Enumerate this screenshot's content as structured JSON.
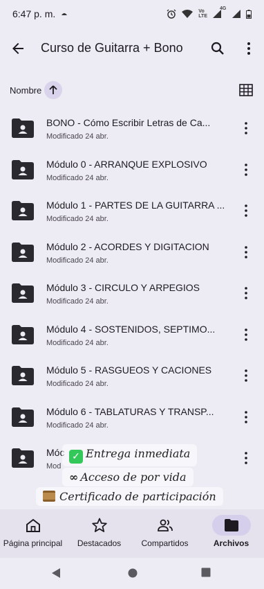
{
  "status_bar": {
    "time": "6:47 p. m.",
    "network_label_top": "Vo",
    "network_label_bottom": "LTE",
    "signal_label": "4G"
  },
  "app_bar": {
    "title": "Curso de Guitarra + Bono"
  },
  "sort": {
    "label": "Nombre"
  },
  "files": [
    {
      "name": "BONO - Cómo Escribir Letras de Ca...",
      "modified": "Modificado 24 abr."
    },
    {
      "name": "Módulo 0 - ARRANQUE EXPLOSIVO",
      "modified": "Modificado 24 abr."
    },
    {
      "name": "Módulo 1 - PARTES DE LA GUITARRA ...",
      "modified": "Modificado 24 abr."
    },
    {
      "name": "Módulo 2 - ACORDES Y DIGITACION",
      "modified": "Modificado 24 abr."
    },
    {
      "name": "Módulo 3 - CIRCULO Y ARPEGIOS",
      "modified": "Modificado 24 abr."
    },
    {
      "name": "Módulo 4 - SOSTENIDOS, SEPTIMO...",
      "modified": "Modificado 24 abr."
    },
    {
      "name": "Módulo 5 - RASGUEOS Y CACIONES",
      "modified": "Modificado 24 abr."
    },
    {
      "name": "Módulo 6 - TABLATURAS Y TRANSP...",
      "modified": "Modificado 24 abr."
    },
    {
      "name": "Móc",
      "modified": "Mod"
    }
  ],
  "promo": {
    "line1": "Entrega inmediata",
    "line2": "Acceso de por vida",
    "line2_symbol": "∞",
    "line3": "Certificado de participación",
    "check_color": "#34c759"
  },
  "bottom_nav": [
    {
      "label": "Página principal",
      "icon": "home-icon"
    },
    {
      "label": "Destacados",
      "icon": "star-icon"
    },
    {
      "label": "Compartidos",
      "icon": "people-icon"
    },
    {
      "label": "Archivos",
      "icon": "folder-icon",
      "active": true
    }
  ],
  "colors": {
    "background": "#edebf4",
    "nav_background": "#e5e2ee",
    "active_pill": "#d5cfec",
    "folder_icon": "#1d1b20"
  }
}
